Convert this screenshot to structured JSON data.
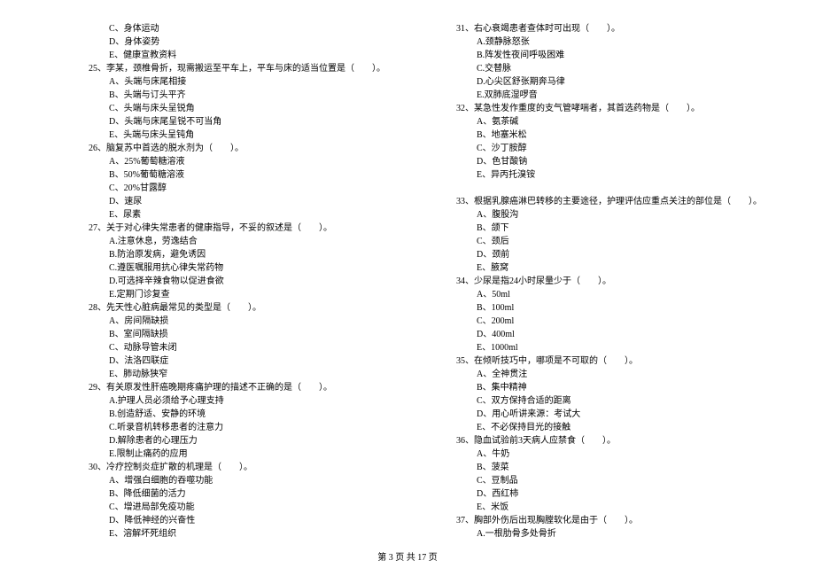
{
  "footer": "第 3 页 共 17 页",
  "left": {
    "orphan_options": [
      "C、身体运动",
      "D、身体姿势",
      "E、健康宣教资料"
    ],
    "questions": [
      {
        "num": "25、",
        "text": "李某，颈椎骨折，现需搬运至平车上，平车与床的适当位置是（　　）。",
        "options": [
          "A、头端与床尾相接",
          "B、头端与订头平齐",
          "C、头端与床头呈锐角",
          "D、头端与床尾呈锐不可当角",
          "E、头端与床头呈钝角"
        ]
      },
      {
        "num": "26、",
        "text": "脑复苏中首选的脱水剂为（　　）。",
        "options": [
          "A、25%葡萄糖溶液",
          "B、50%葡萄糖溶液",
          "C、20%甘露醇",
          "D、速尿",
          "E、尿素"
        ]
      },
      {
        "num": "27、",
        "text": "关于对心律失常患者的健康指导，不妥的叙述是（　　）。",
        "options": [
          "A.注意休息，劳逸结合",
          "B.防治原发病，避免诱因",
          "C.遵医嘱服用抗心律失常药物",
          "D.可选择辛辣食物以促进食欲",
          "E.定期门诊复查"
        ]
      },
      {
        "num": "28、",
        "text": "先天性心脏病最常见的类型是（　　）。",
        "options": [
          "A、房间隔缺损",
          "B、室间隔缺损",
          "C、动脉导管未闭",
          "D、法洛四联症",
          "E、肺动脉狭窄"
        ]
      },
      {
        "num": "29、",
        "text": "有关原发性肝癌晚期疼痛护理的描述不正确的是（　　）。",
        "options": [
          "A.护理人员必须给予心理支持",
          "B.创造舒适、安静的环境",
          "C.听录音机转移患者的注意力",
          "D.解除患者的心理压力",
          "E.限制止痛药的应用"
        ]
      },
      {
        "num": "30、",
        "text": "冷疗控制炎症扩散的机理是（　　）。",
        "options": [
          "A、增强白细胞的吞噬功能",
          "B、降低细菌的活力",
          "C、增进局部免疫功能",
          "D、降低神经的兴奋性",
          "E、溶解坏死组织"
        ]
      }
    ]
  },
  "right": {
    "questions": [
      {
        "num": "31、",
        "text": "右心衰竭患者查体时可出现（　　）。",
        "options": [
          "A.颈静脉怒张",
          "B.阵发性夜间呼吸困难",
          "C.交替脉",
          "D.心尖区舒张期奔马律",
          "E.双肺底湿啰音"
        ]
      },
      {
        "num": "32、",
        "text": "某急性发作重度的支气管哮喘者，其首选药物是（　　）。",
        "options": [
          "A、氨茶碱",
          "B、地塞米松",
          "C、沙丁胺醇",
          "D、色甘酸钠",
          "E、异丙托溴铵"
        ]
      },
      {
        "num": "33、",
        "text": "根据乳腺癌淋巴转移的主要途径，护理评估应重点关注的部位是（　　）。",
        "options": [
          "A、腹股沟",
          "B、颌下",
          "C、颈后",
          "D、颈前",
          "E、腋窝"
        ]
      },
      {
        "num": "34、",
        "text": "少尿是指24小时尿量少于（　　）。",
        "options": [
          "A、50ml",
          "B、100ml",
          "C、200ml",
          "D、400ml",
          "E、1000ml"
        ]
      },
      {
        "num": "35、",
        "text": "在倾听技巧中，哪项是不可取的（　　）。",
        "options": [
          "A、全神贯注",
          "B、集中精神",
          "C、双方保持合适的距离",
          "D、用心听讲来源：考试大",
          "E、不必保持目光的接触"
        ]
      },
      {
        "num": "36、",
        "text": "隐血试验前3天病人应禁食（　　）。",
        "options": [
          "A、牛奶",
          "B、菠菜",
          "C、豆制品",
          "D、西红柿",
          "E、米饭"
        ]
      },
      {
        "num": "37、",
        "text": "胸部外伤后出现胸膛软化是由于（　　）。",
        "options": [
          "A.一根肋骨多处骨折"
        ]
      }
    ]
  }
}
